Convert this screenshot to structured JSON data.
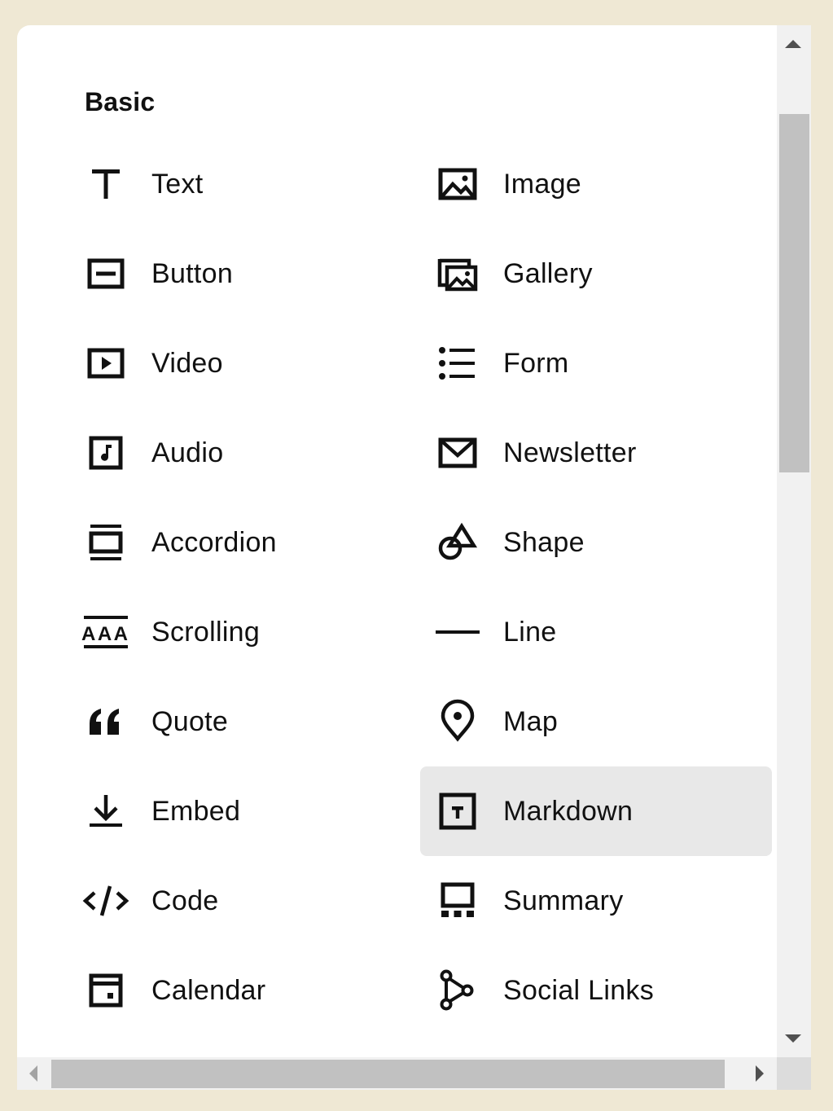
{
  "section": {
    "title": "Basic"
  },
  "blocks": {
    "left": [
      {
        "label": "Text",
        "icon": "text-icon"
      },
      {
        "label": "Button",
        "icon": "button-icon"
      },
      {
        "label": "Video",
        "icon": "video-icon"
      },
      {
        "label": "Audio",
        "icon": "audio-icon"
      },
      {
        "label": "Accordion",
        "icon": "accordion-icon"
      },
      {
        "label": "Scrolling",
        "icon": "scrolling-icon"
      },
      {
        "label": "Quote",
        "icon": "quote-icon"
      },
      {
        "label": "Embed",
        "icon": "embed-icon"
      },
      {
        "label": "Code",
        "icon": "code-icon"
      },
      {
        "label": "Calendar",
        "icon": "calendar-icon"
      }
    ],
    "right": [
      {
        "label": "Image",
        "icon": "image-icon"
      },
      {
        "label": "Gallery",
        "icon": "gallery-icon"
      },
      {
        "label": "Form",
        "icon": "form-icon"
      },
      {
        "label": "Newsletter",
        "icon": "newsletter-icon"
      },
      {
        "label": "Shape",
        "icon": "shape-icon"
      },
      {
        "label": "Line",
        "icon": "line-icon"
      },
      {
        "label": "Map",
        "icon": "map-pin-icon"
      },
      {
        "label": "Markdown",
        "icon": "markdown-icon",
        "selected": true
      },
      {
        "label": "Summary",
        "icon": "summary-icon"
      },
      {
        "label": "Social Links",
        "icon": "social-links-icon"
      }
    ]
  },
  "colors": {
    "page_background": "#efe8d4",
    "panel_background": "#ffffff",
    "selected_background": "#e8e8e8",
    "icon_color": "#111111"
  }
}
